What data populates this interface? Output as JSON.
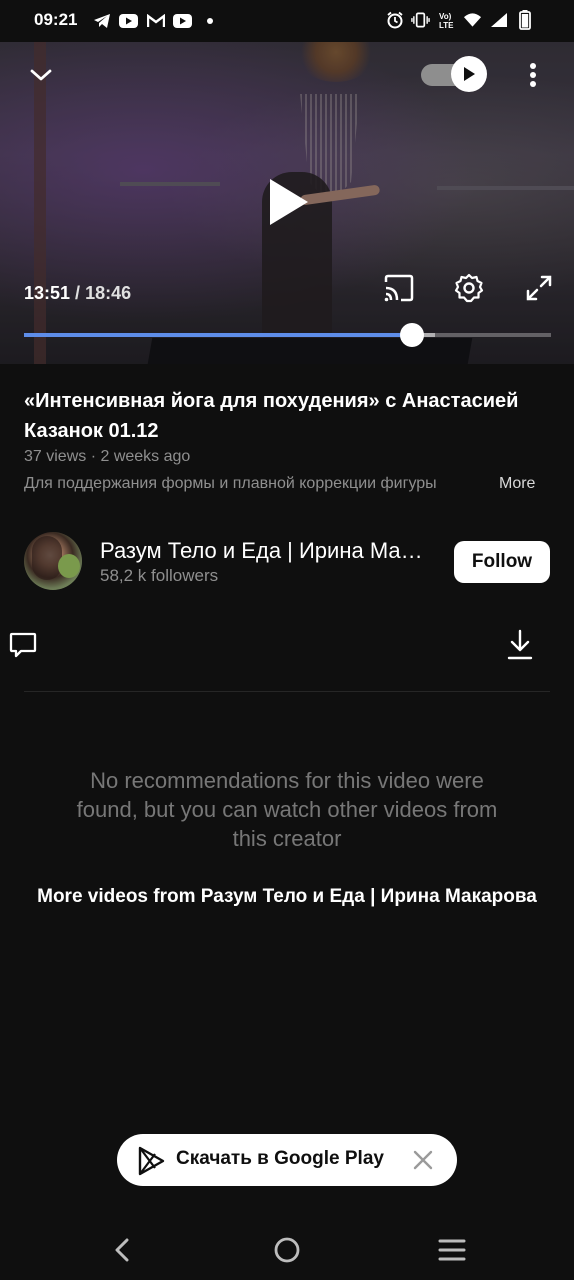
{
  "status_bar": {
    "time": "09:21",
    "left_icons": [
      "telegram-icon",
      "youtube-icon",
      "gmail-icon",
      "youtube-icon",
      "dot-icon"
    ],
    "right_icons": [
      "alarm-icon",
      "vibrate-icon",
      "volte-icon",
      "wifi-icon",
      "signal-icon",
      "battery-icon"
    ],
    "volte_label": "Vo) LTE"
  },
  "player": {
    "current_time": "13:51",
    "separator": " / ",
    "duration": "18:46",
    "progress_fraction": 0.737,
    "buffered_fraction": 0.78,
    "autoplay_on": true,
    "accent_color": "#5e8de9"
  },
  "video": {
    "title": "«Интенсивная йога для похудения» с Анастасией Казанок 01.12",
    "meta": "37 views · 2 weeks ago",
    "description": "Для поддержания формы и плавной коррекции фигуры",
    "more_label": "More"
  },
  "channel": {
    "name": "Разум Тело и Еда | Ирина Макарова",
    "followers": "58,2 k followers",
    "follow_label": "Follow"
  },
  "recommendations": {
    "empty_message": "No recommendations for this video were found, but you can watch other videos from this creator",
    "more_videos_label": "More videos from Разум Тело и Еда | Ирина Макарова"
  },
  "banner": {
    "label": "Скачать в Google Play"
  }
}
